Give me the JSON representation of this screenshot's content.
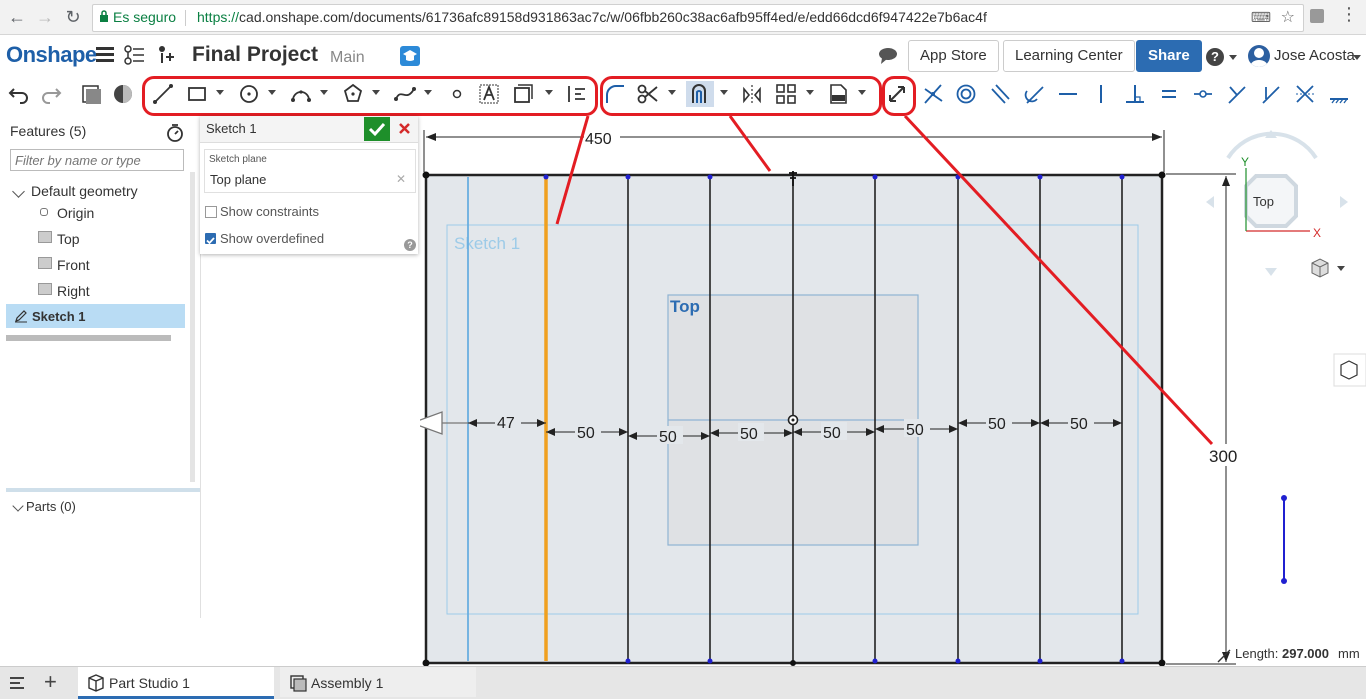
{
  "browser": {
    "secure_label": "Es seguro",
    "url_scheme": "https://",
    "url_rest": "cad.onshape.com/documents/61736afc89158d931863ac7c/w/06fbb260c38ac6afb95ff4ed/e/edd66dcd6f947422e7b6ac4f"
  },
  "app": {
    "logo": "Onshape",
    "doc_title": "Final Project",
    "branch": "Main",
    "app_store": "App Store",
    "learning_center": "Learning Center",
    "share": "Share",
    "user": "Jose Acosta"
  },
  "features": {
    "header": "Features (5)",
    "filter_placeholder": "Filter by name or type",
    "items": [
      "Default geometry",
      "Origin",
      "Top",
      "Front",
      "Right",
      "Sketch 1"
    ],
    "parts": "Parts (0)"
  },
  "sketch_dialog": {
    "title": "Sketch 1",
    "plane_label": "Sketch plane",
    "plane_value": "Top plane",
    "show_constraints": "Show constraints",
    "show_overdefined": "Show overdefined"
  },
  "viewport": {
    "sketch_label": "Sketch 1",
    "plane_label": "Top",
    "dim_width": "450",
    "dim_height": "300",
    "dims": [
      "47",
      "50",
      "50",
      "50",
      "50",
      "50",
      "50",
      "50"
    ],
    "view_cube_label": "Top",
    "axis_x": "X",
    "axis_y": "Y",
    "length_label": "Length:",
    "length_value": "297.000",
    "length_unit": "mm"
  },
  "tabs": {
    "part_studio": "Part Studio 1",
    "assembly": "Assembly 1"
  },
  "colors": {
    "accent": "#2c6cb2",
    "highlight": "#e31d23",
    "selected_line": "#f0a020"
  }
}
